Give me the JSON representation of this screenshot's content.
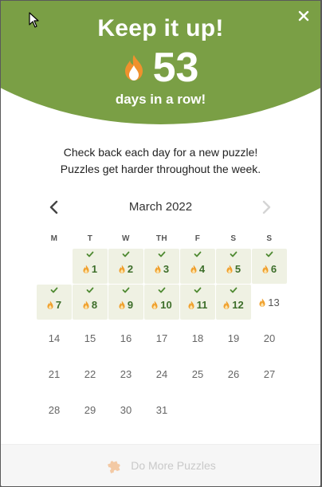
{
  "header": {
    "title": "Keep it up!",
    "streak_count": "53",
    "streak_label": "days in a row!",
    "accent_color": "#7a9f45"
  },
  "message": {
    "line1": "Check back each day for a new puzzle!",
    "line2": "Puzzles get harder throughout the week."
  },
  "calendar": {
    "month": "March 2022",
    "weekdays": [
      "M",
      "T",
      "W",
      "TH",
      "F",
      "S",
      "S"
    ],
    "days": [
      {
        "day": "",
        "state": "empty"
      },
      {
        "day": "1",
        "state": "done"
      },
      {
        "day": "2",
        "state": "done"
      },
      {
        "day": "3",
        "state": "done"
      },
      {
        "day": "4",
        "state": "done"
      },
      {
        "day": "5",
        "state": "done"
      },
      {
        "day": "6",
        "state": "done"
      },
      {
        "day": "7",
        "state": "done"
      },
      {
        "day": "8",
        "state": "done"
      },
      {
        "day": "9",
        "state": "done"
      },
      {
        "day": "10",
        "state": "done"
      },
      {
        "day": "11",
        "state": "done"
      },
      {
        "day": "12",
        "state": "done"
      },
      {
        "day": "13",
        "state": "today"
      },
      {
        "day": "14",
        "state": "future"
      },
      {
        "day": "15",
        "state": "future"
      },
      {
        "day": "16",
        "state": "future"
      },
      {
        "day": "17",
        "state": "future"
      },
      {
        "day": "18",
        "state": "future"
      },
      {
        "day": "19",
        "state": "future"
      },
      {
        "day": "20",
        "state": "future"
      },
      {
        "day": "21",
        "state": "future"
      },
      {
        "day": "22",
        "state": "future"
      },
      {
        "day": "23",
        "state": "future"
      },
      {
        "day": "24",
        "state": "future"
      },
      {
        "day": "25",
        "state": "future"
      },
      {
        "day": "26",
        "state": "future"
      },
      {
        "day": "27",
        "state": "future"
      },
      {
        "day": "28",
        "state": "future"
      },
      {
        "day": "29",
        "state": "future"
      },
      {
        "day": "30",
        "state": "future"
      },
      {
        "day": "31",
        "state": "future"
      }
    ]
  },
  "footer": {
    "label": "Do More Puzzles",
    "icon": "puzzle-piece-icon"
  },
  "icons": {
    "close": "close-icon",
    "flame": "flame-icon",
    "check": "check-icon",
    "prev": "chevron-left-icon",
    "next": "chevron-right-icon"
  }
}
